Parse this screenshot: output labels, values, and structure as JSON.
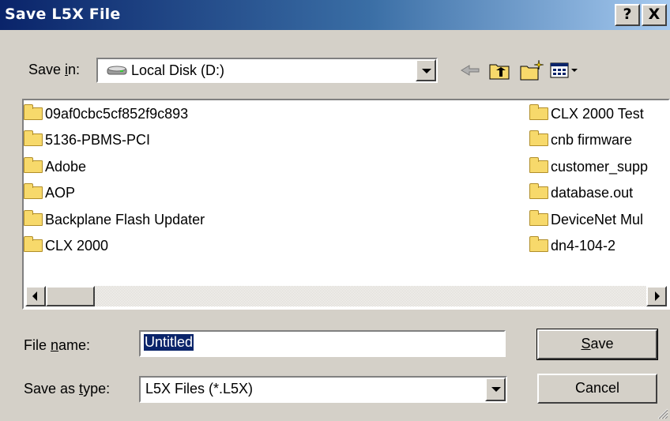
{
  "window": {
    "title": "Save L5X File",
    "help_label": "?",
    "close_label": "X"
  },
  "save_in": {
    "label_pre": "Save ",
    "label_accel": "i",
    "label_post": "n:",
    "value": "Local Disk (D:)"
  },
  "toolbar": {
    "icons": [
      "back-arrow-icon",
      "up-folder-icon",
      "new-folder-icon",
      "view-menu-icon"
    ]
  },
  "files": {
    "left_column": [
      "09af0cbc5cf852f9c893",
      "5136-PBMS-PCI",
      "Adobe",
      "AOP",
      "Backplane Flash Updater",
      "CLX 2000"
    ],
    "right_column": [
      "CLX 2000 Test",
      "cnb firmware",
      "customer_supp",
      "database.out",
      "DeviceNet Mul",
      "dn4-104-2"
    ]
  },
  "file_name": {
    "label_pre": "File ",
    "label_accel": "n",
    "label_post": "ame:",
    "value": "Untitled"
  },
  "save_as_type": {
    "label_pre": "Save as ",
    "label_accel": "t",
    "label_post": "ype:",
    "value": "L5X Files (*.L5X)"
  },
  "buttons": {
    "save_accel": "S",
    "save_rest": "ave",
    "cancel": "Cancel"
  },
  "colors": {
    "title_gradient_start": "#0a246a",
    "title_gradient_end": "#a6caf0",
    "dialog_bg": "#d4d0c8",
    "selection": "#0a246a",
    "folder": "#f7d96b"
  }
}
